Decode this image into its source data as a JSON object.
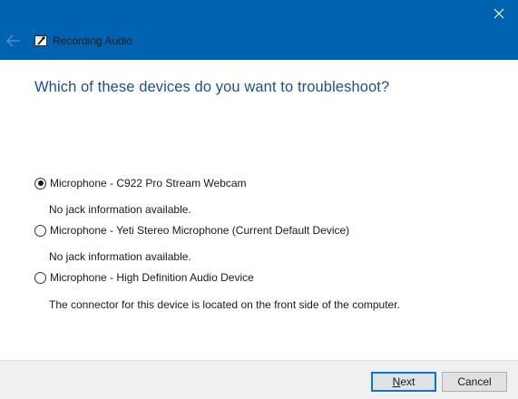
{
  "window": {
    "title": "Recording Audio",
    "accent_color": "#0063b1",
    "close_icon": "close-icon",
    "back_icon": "back-arrow-icon"
  },
  "main": {
    "heading": "Which of these devices do you want to troubleshoot?",
    "options": [
      {
        "label": "Microphone - C922 Pro Stream Webcam",
        "description": "No jack information available.",
        "selected": true
      },
      {
        "label": "Microphone - Yeti Stereo Microphone (Current Default Device)",
        "description": "No jack information available.",
        "selected": false
      },
      {
        "label": "Microphone - High Definition Audio Device",
        "description": "The connector for this device is located on the front side of the computer.",
        "selected": false
      }
    ]
  },
  "footer": {
    "next_label_first": "N",
    "next_label_rest": "ext",
    "cancel_label": "Cancel"
  }
}
